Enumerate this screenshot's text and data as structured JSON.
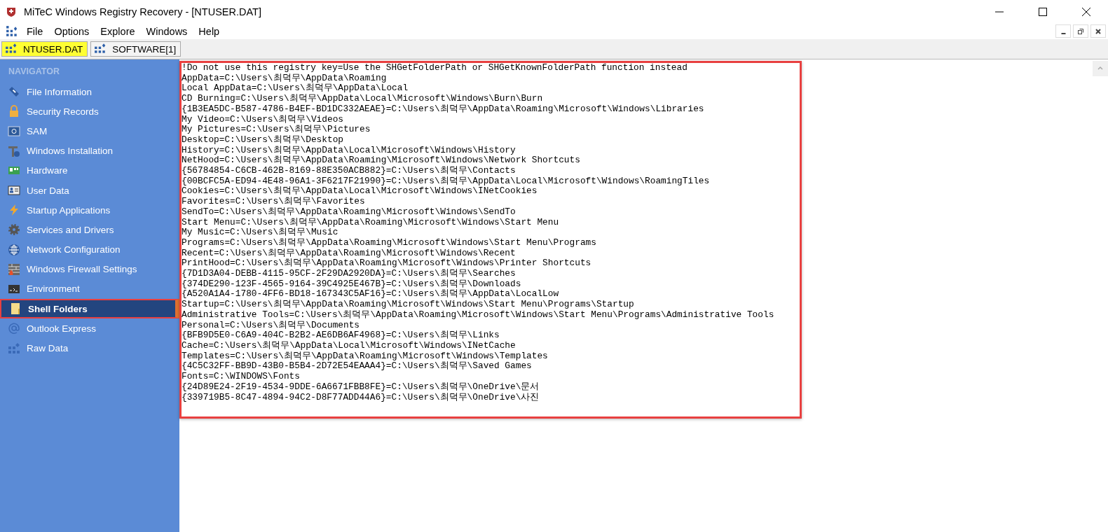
{
  "window": {
    "title": "MiTeC Windows Registry Recovery - [NTUSER.DAT]"
  },
  "menu": [
    "File",
    "Options",
    "Explore",
    "Windows",
    "Help"
  ],
  "tabs": [
    {
      "label": "NTUSER.DAT",
      "selected": true
    },
    {
      "label": "SOFTWARE[1]",
      "selected": false
    }
  ],
  "navigator": {
    "heading": "NAVIGATOR",
    "items": [
      {
        "label": "File Information",
        "selected": false
      },
      {
        "label": "Security Records",
        "selected": false
      },
      {
        "label": "SAM",
        "selected": false
      },
      {
        "label": "Windows Installation",
        "selected": false
      },
      {
        "label": "Hardware",
        "selected": false
      },
      {
        "label": "User Data",
        "selected": false
      },
      {
        "label": "Startup Applications",
        "selected": false
      },
      {
        "label": "Services and Drivers",
        "selected": false
      },
      {
        "label": "Network Configuration",
        "selected": false
      },
      {
        "label": "Windows Firewall Settings",
        "selected": false
      },
      {
        "label": "Environment",
        "selected": false
      },
      {
        "label": "Shell Folders",
        "selected": true
      },
      {
        "label": "Outlook Express",
        "selected": false
      },
      {
        "label": "Raw Data",
        "selected": false
      }
    ]
  },
  "content": {
    "lines": [
      "!Do not use this registry key=Use the SHGetFolderPath or SHGetKnownFolderPath function instead",
      "AppData=C:\\Users\\최덕무\\AppData\\Roaming",
      "Local AppData=C:\\Users\\최덕무\\AppData\\Local",
      "CD Burning=C:\\Users\\최덕무\\AppData\\Local\\Microsoft\\Windows\\Burn\\Burn",
      "{1B3EA5DC-B587-4786-B4EF-BD1DC332AEAE}=C:\\Users\\최덕무\\AppData\\Roaming\\Microsoft\\Windows\\Libraries",
      "My Video=C:\\Users\\최덕무\\Videos",
      "My Pictures=C:\\Users\\최덕무\\Pictures",
      "Desktop=C:\\Users\\최덕무\\Desktop",
      "History=C:\\Users\\최덕무\\AppData\\Local\\Microsoft\\Windows\\History",
      "NetHood=C:\\Users\\최덕무\\AppData\\Roaming\\Microsoft\\Windows\\Network Shortcuts",
      "{56784854-C6CB-462B-8169-88E350ACB882}=C:\\Users\\최덕무\\Contacts",
      "{00BCFC5A-ED94-4E48-96A1-3F6217F21990}=C:\\Users\\최덕무\\AppData\\Local\\Microsoft\\Windows\\RoamingTiles",
      "Cookies=C:\\Users\\최덕무\\AppData\\Local\\Microsoft\\Windows\\INetCookies",
      "Favorites=C:\\Users\\최덕무\\Favorites",
      "SendTo=C:\\Users\\최덕무\\AppData\\Roaming\\Microsoft\\Windows\\SendTo",
      "Start Menu=C:\\Users\\최덕무\\AppData\\Roaming\\Microsoft\\Windows\\Start Menu",
      "My Music=C:\\Users\\최덕무\\Music",
      "Programs=C:\\Users\\최덕무\\AppData\\Roaming\\Microsoft\\Windows\\Start Menu\\Programs",
      "Recent=C:\\Users\\최덕무\\AppData\\Roaming\\Microsoft\\Windows\\Recent",
      "PrintHood=C:\\Users\\최덕무\\AppData\\Roaming\\Microsoft\\Windows\\Printer Shortcuts",
      "{7D1D3A04-DEBB-4115-95CF-2F29DA2920DA}=C:\\Users\\최덕무\\Searches",
      "{374DE290-123F-4565-9164-39C4925E467B}=C:\\Users\\최덕무\\Downloads",
      "{A520A1A4-1780-4FF6-BD18-167343C5AF16}=C:\\Users\\최덕무\\AppData\\LocalLow",
      "Startup=C:\\Users\\최덕무\\AppData\\Roaming\\Microsoft\\Windows\\Start Menu\\Programs\\Startup",
      "Administrative Tools=C:\\Users\\최덕무\\AppData\\Roaming\\Microsoft\\Windows\\Start Menu\\Programs\\Administrative Tools",
      "Personal=C:\\Users\\최덕무\\Documents",
      "{BFB9D5E0-C6A9-404C-B2B2-AE6DB6AF4968}=C:\\Users\\최덕무\\Links",
      "Cache=C:\\Users\\최덕무\\AppData\\Local\\Microsoft\\Windows\\INetCache",
      "Templates=C:\\Users\\최덕무\\AppData\\Roaming\\Microsoft\\Windows\\Templates",
      "{4C5C32FF-BB9D-43B0-B5B4-2D72E54EAAA4}=C:\\Users\\최덕무\\Saved Games",
      "Fonts=C:\\WINDOWS\\Fonts",
      "{24D89E24-2F19-4534-9DDE-6A6671FBB8FE}=C:\\Users\\최덕무\\OneDrive\\문서",
      "{339719B5-8C47-4894-94C2-D8F77ADD44A6}=C:\\Users\\최덕무\\OneDrive\\사진"
    ]
  }
}
